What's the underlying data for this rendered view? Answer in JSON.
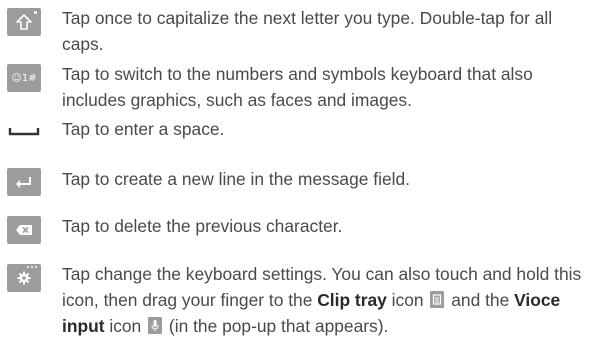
{
  "rows": [
    {
      "icon": "shift-arrow-icon",
      "text": "Tap once to capitalize the next letter you type. Double-tap for all caps."
    },
    {
      "icon": "symbols-key-icon",
      "key_label": "☺1#",
      "text": "Tap to switch to the numbers and symbols keyboard that also includes graphics, such as faces and images."
    },
    {
      "icon": "space-bar-icon",
      "text": "Tap to enter a space."
    },
    {
      "icon": "enter-arrow-icon",
      "text": "Tap to create a new line in the message field."
    },
    {
      "icon": "backspace-icon",
      "text": "Tap to delete the previous character."
    },
    {
      "icon": "settings-gear-icon",
      "text_part1": "Tap change the keyboard settings. You can also touch and hold this icon, then drag your finger to the ",
      "bold1": "Clip tray",
      "text_part2": " icon ",
      "text_part3": " and the ",
      "bold2": "Vioce input",
      "text_part4": " icon ",
      "text_part5": " (in the pop-up that appears)."
    }
  ],
  "colors": {
    "key_bg": "#9c9c9c",
    "text": "#4a4a4a"
  }
}
